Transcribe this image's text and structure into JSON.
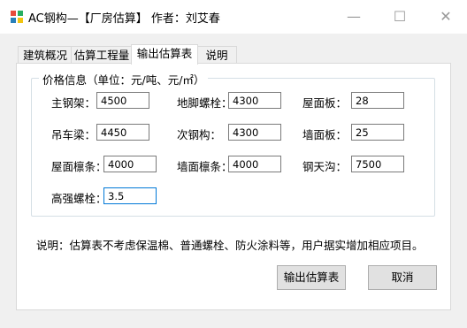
{
  "window": {
    "title": "AC钢构—【厂房估算】 作者：刘艾春",
    "minimize": "—",
    "maximize": "☐",
    "close": "✕"
  },
  "tabs": [
    {
      "label": "建筑概况"
    },
    {
      "label": "估算工程量"
    },
    {
      "label": "输出估算表",
      "active": true
    },
    {
      "label": "说明"
    }
  ],
  "price_group": {
    "title": "价格信息（单位：元/吨、元/㎡）",
    "fields": [
      {
        "label": "主钢架：",
        "value": "4500"
      },
      {
        "label": "地脚螺栓：",
        "value": "4300"
      },
      {
        "label": "屋面板：",
        "value": "28"
      },
      {
        "label": "吊车梁：",
        "value": "4450"
      },
      {
        "label": "次钢构：",
        "value": "4300"
      },
      {
        "label": "墙面板：",
        "value": "25"
      },
      {
        "label": "屋面檩条：",
        "value": "4000"
      },
      {
        "label": "墙面檩条：",
        "value": "4000"
      },
      {
        "label": "钢天沟：",
        "value": "7500"
      },
      {
        "label": "高强螺栓：",
        "value": "3.5"
      }
    ]
  },
  "note": "说明：估算表不考虑保温棉、普通螺栓、防火涂料等，用户据实增加相应项目。",
  "buttons": {
    "output": "输出估算表",
    "cancel": "取消"
  }
}
